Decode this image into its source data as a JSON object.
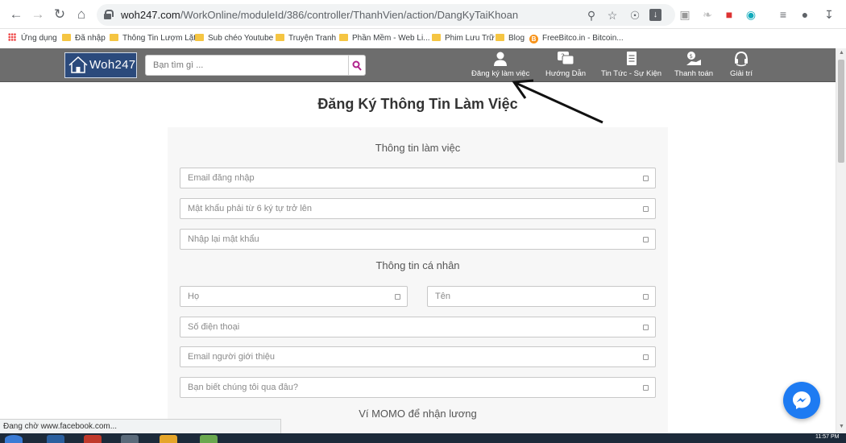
{
  "browser": {
    "url_host": "woh247.com",
    "url_path": "/WorkOnline/moduleId/386/controller/ThanhVien/action/DangKyTaiKhoan",
    "bookmarks": [
      {
        "label": "Ứng dụng",
        "icon": "apps-grid-icon"
      },
      {
        "label": "Đã nhập",
        "icon": "folder-icon"
      },
      {
        "label": "Thông Tin Lượm Lặt",
        "icon": "folder-icon"
      },
      {
        "label": "Sub chéo Youtube",
        "icon": "folder-icon"
      },
      {
        "label": "Truyện Tranh",
        "icon": "folder-icon"
      },
      {
        "label": "Phần Mềm - Web Li...",
        "icon": "folder-icon"
      },
      {
        "label": "Phim Lưu Trữ",
        "icon": "folder-icon"
      },
      {
        "label": "Blog",
        "icon": "folder-icon"
      },
      {
        "label": "FreeBitco.in - Bitcoin...",
        "icon": "bitcoin-icon"
      }
    ],
    "status_text": "Đang chờ www.facebook.com...",
    "clock": "11:57 PM"
  },
  "site": {
    "logo_text": "Woh247",
    "search_placeholder": "Bạn tìm gì ...",
    "nav": [
      {
        "label": "Đăng ký làm việc",
        "icon": "user-icon"
      },
      {
        "label": "Hướng Dẫn",
        "icon": "help-chat-icon"
      },
      {
        "label": "Tin Tức - Sự Kiện",
        "icon": "news-icon"
      },
      {
        "label": "Thanh toán",
        "icon": "payment-icon"
      },
      {
        "label": "Giải trí",
        "icon": "headset-icon"
      }
    ],
    "header_color": "#6d6d6d",
    "logo_color": "#2b4a7c"
  },
  "form": {
    "title": "Đăng Ký Thông Tin Làm Việc",
    "section_work": "Thông tin làm việc",
    "email_placeholder": "Email đăng nhập",
    "password_placeholder": "Mật khẩu phải từ 6 ký tự trở lên",
    "confirm_password_placeholder": "Nhập lại mật khẩu",
    "section_personal": "Thông tin cá nhân",
    "last_name_placeholder": "Họ",
    "first_name_placeholder": "Tên",
    "phone_placeholder": "Số điện thoại",
    "referrer_email_placeholder": "Email người giới thiệu",
    "source_placeholder": "Bạn biết chúng tôi qua đâu?",
    "section_momo": "Ví MOMO để nhận lương"
  }
}
